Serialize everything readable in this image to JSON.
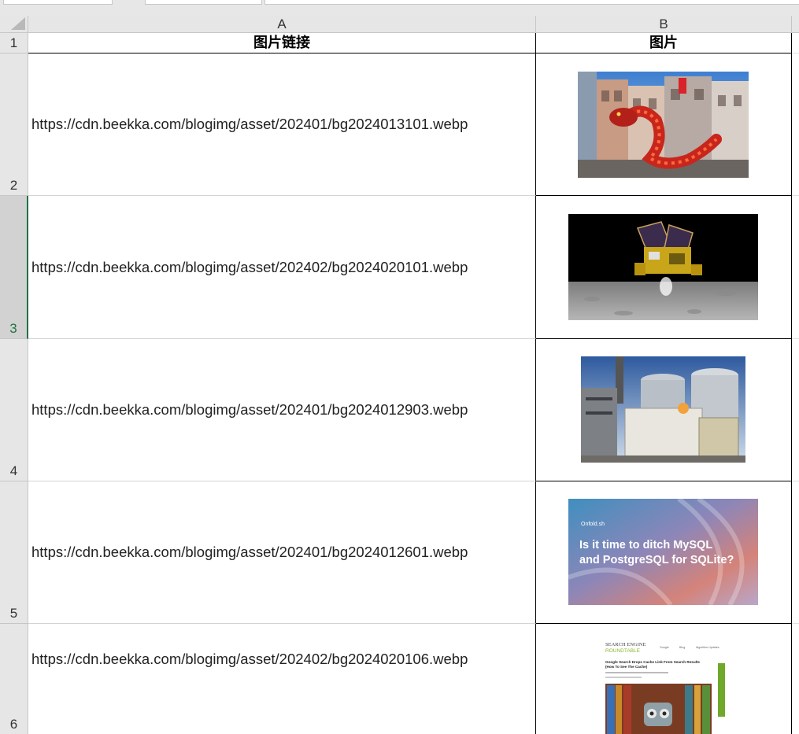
{
  "columns": [
    {
      "letter": "A"
    },
    {
      "letter": "B"
    }
  ],
  "rows": [
    "1",
    "2",
    "3",
    "4",
    "5",
    "6"
  ],
  "headers": {
    "url": "图片链接",
    "image": "图片"
  },
  "items": [
    {
      "url": "https://cdn.beekka.com/blogimg/asset/202401/bg2024013101.webp"
    },
    {
      "url": "https://cdn.beekka.com/blogimg/asset/202402/bg2024020101.webp"
    },
    {
      "url": "https://cdn.beekka.com/blogimg/asset/202401/bg2024012903.webp"
    },
    {
      "url": "https://cdn.beekka.com/blogimg/asset/202401/bg2024012601.webp",
      "thumb_small": "Onfold.sh",
      "thumb_line1": "Is it time to ditch MySQL",
      "thumb_line2": "and PostgreSQL for SQLite?"
    },
    {
      "url": "https://cdn.beekka.com/blogimg/asset/202402/bg2024020106.webp",
      "thumb_logo1": "SEARCH ENGINE",
      "thumb_logo2": "ROUNDTABLE",
      "thumb_nav": [
        "Google",
        "Bing",
        "Algorithm Updates"
      ],
      "thumb_title1": "Google Search Drops Cache Link From Search Results",
      "thumb_title2": "(How To See The Cache)"
    }
  ],
  "colors": {
    "grid_header_bg": "#e6e6e6",
    "selection_green": "#217346",
    "srt_green": "#8ab833"
  }
}
